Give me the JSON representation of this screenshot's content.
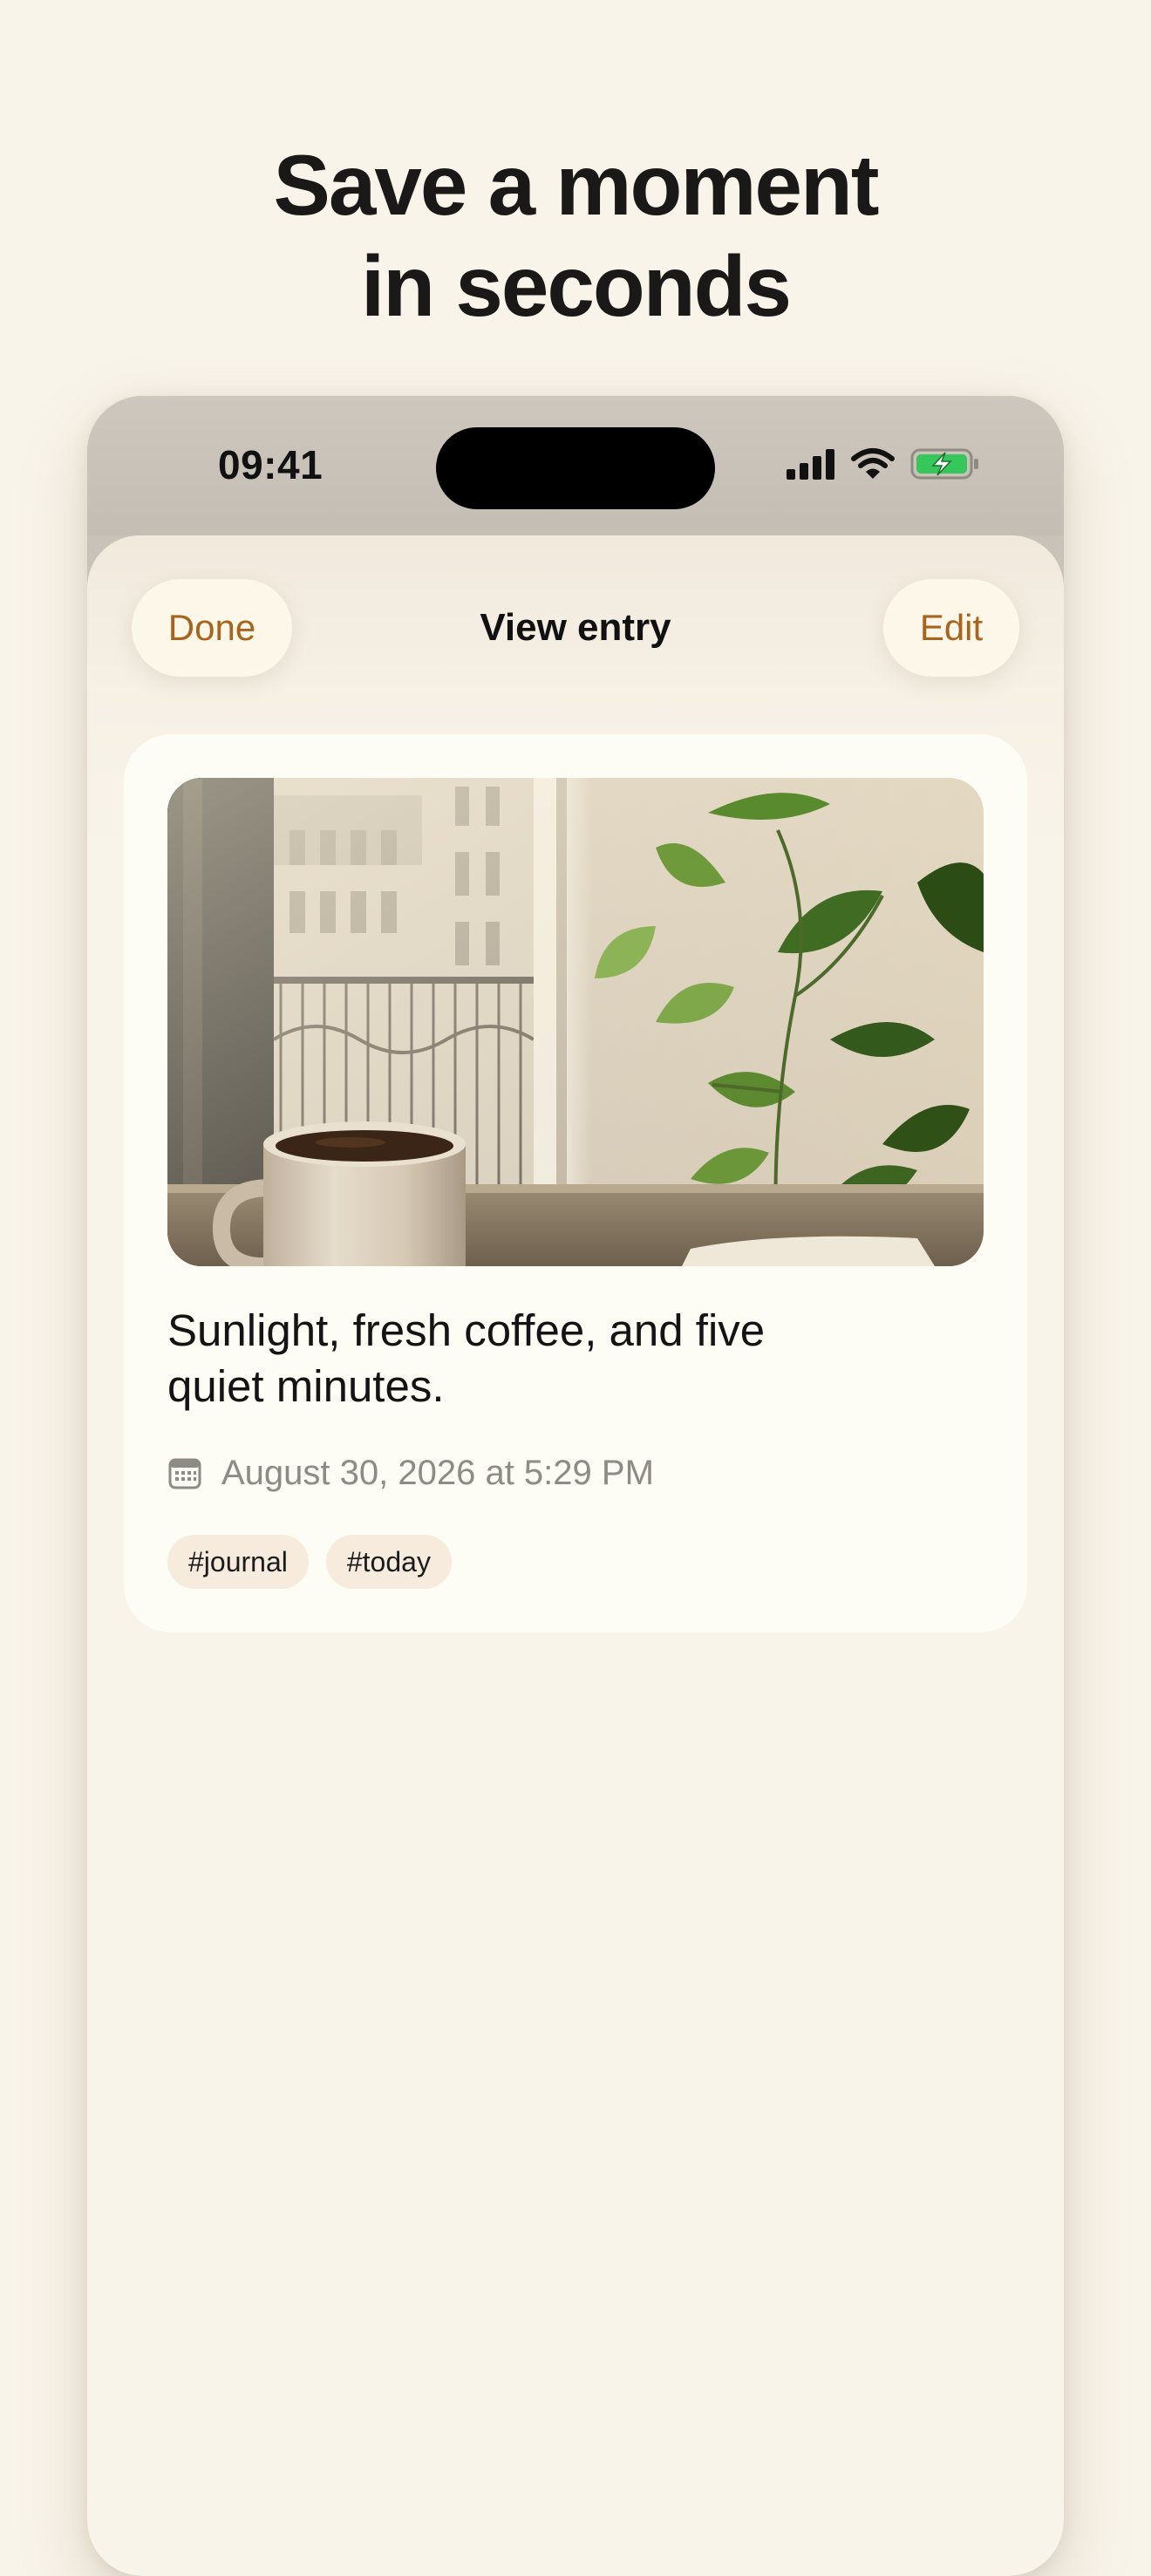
{
  "headline": {
    "line1": "Save a moment",
    "line2": "in seconds"
  },
  "status_bar": {
    "time": "09:41",
    "icons": [
      "cellular-signal-icon",
      "wifi-icon",
      "battery-charging-icon"
    ],
    "battery_color": "#35c759"
  },
  "nav": {
    "done_label": "Done",
    "title": "View entry",
    "edit_label": "Edit"
  },
  "entry": {
    "photo_icon": "photo-coffee-window-plant",
    "text_line1": "Sunlight, fresh coffee, and five",
    "text_line2": "quiet minutes.",
    "date_icon": "calendar-icon",
    "date": "August 30, 2026 at 5:29 PM",
    "tags": [
      "#journal",
      "#today"
    ]
  },
  "colors": {
    "page_background": "#f9f4ea",
    "accent": "#a8641c",
    "button_background": "#fcf7e8",
    "card_background": "#fdfcf5",
    "tag_background": "#f6ebdc"
  }
}
